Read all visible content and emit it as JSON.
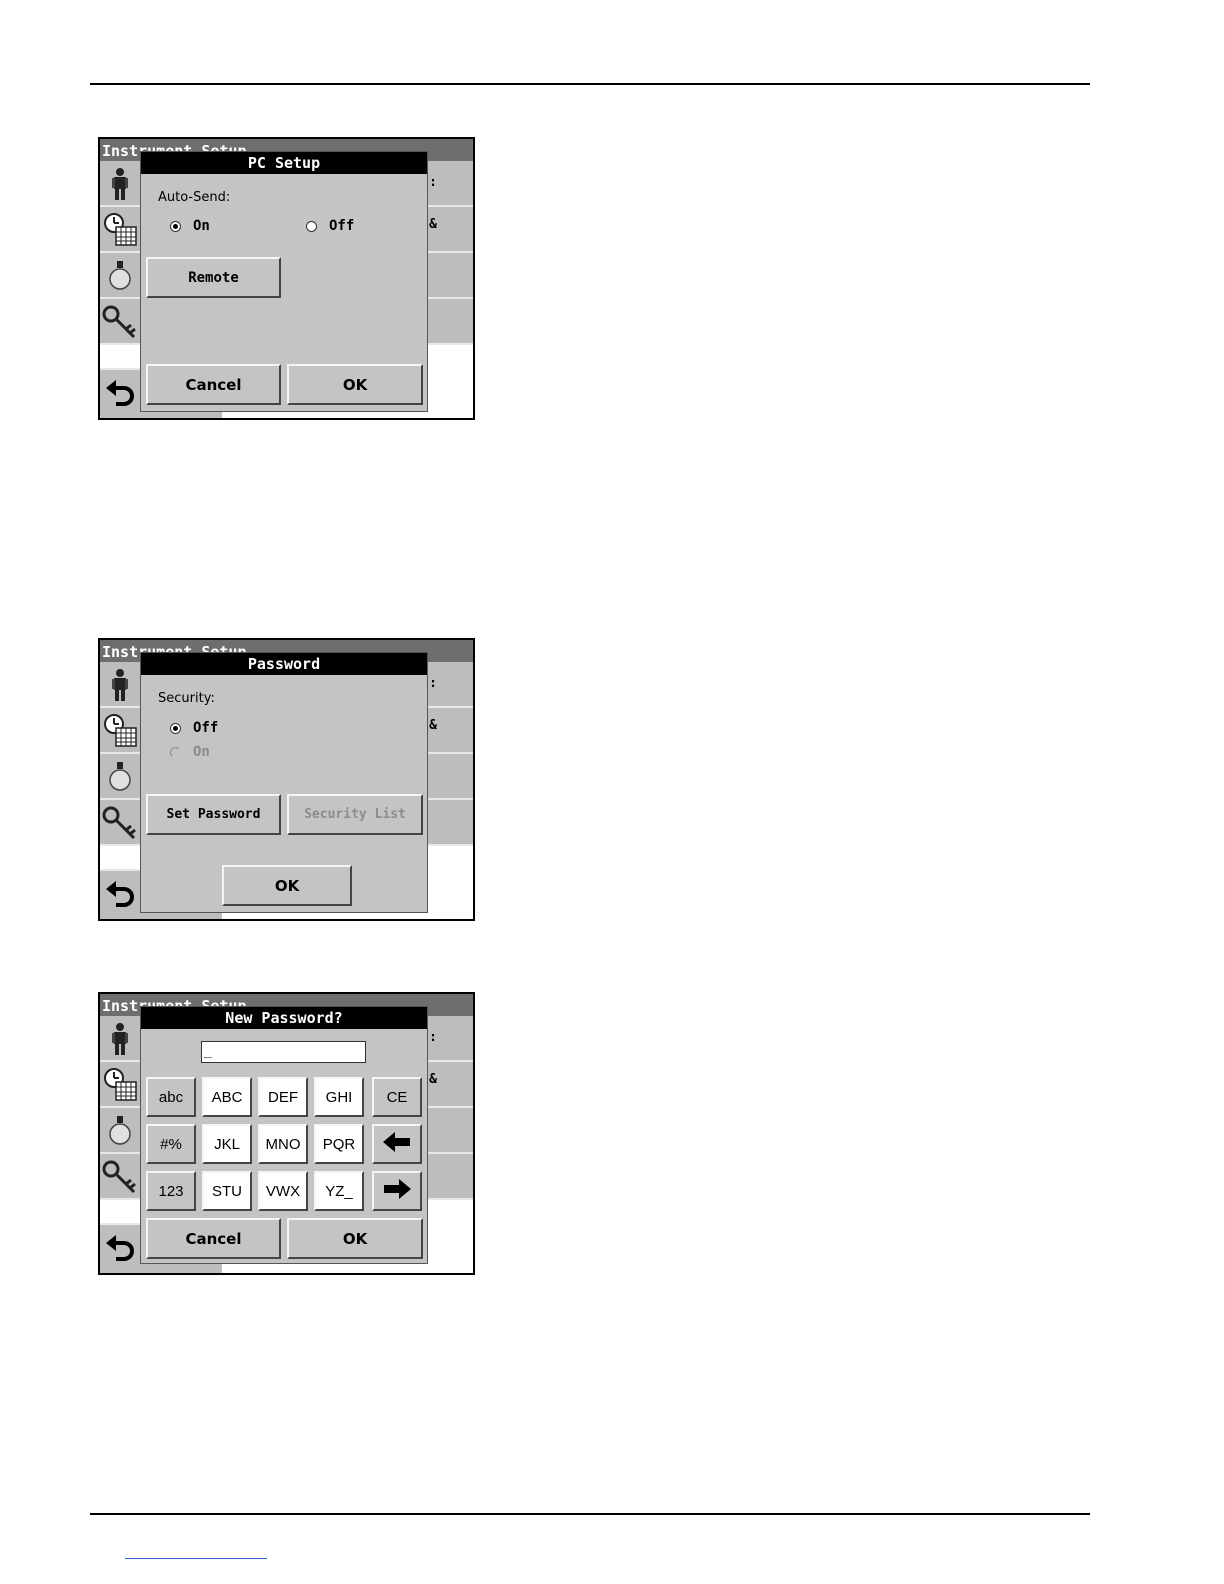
{
  "background_screen": {
    "title": "Instrument Setup",
    "row_fragments": [
      ":",
      "&"
    ]
  },
  "screens": {
    "pc_setup": {
      "title": "PC Setup",
      "auto_send_label": "Auto-Send:",
      "options": [
        {
          "label": "On",
          "selected": true
        },
        {
          "label": "Off",
          "selected": false
        }
      ],
      "remote_button": "Remote",
      "cancel_button": "Cancel",
      "ok_button": "OK"
    },
    "password": {
      "title": "Password",
      "security_label": "Security:",
      "options": [
        {
          "label": "Off",
          "selected": true,
          "enabled": true
        },
        {
          "label": "On",
          "selected": false,
          "enabled": false
        }
      ],
      "set_password_button": "Set Password",
      "security_list_button": "Security List",
      "ok_button": "OK"
    },
    "new_password": {
      "title": "New Password?",
      "input_value": "_",
      "keys": {
        "row1": [
          "abc",
          "ABC",
          "DEF",
          "GHI",
          "CE"
        ],
        "row2": [
          "#%",
          "JKL",
          "MNO",
          "PQR"
        ],
        "row3": [
          "123",
          "STU",
          "VWX",
          "YZ_"
        ]
      },
      "cancel_button": "Cancel",
      "ok_button": "OK"
    }
  },
  "icons": [
    "person-icon",
    "clock-calendar-icon",
    "lamp-icon",
    "key-icon",
    "back-arrow-icon",
    "arrow-left-icon",
    "arrow-right-icon"
  ]
}
